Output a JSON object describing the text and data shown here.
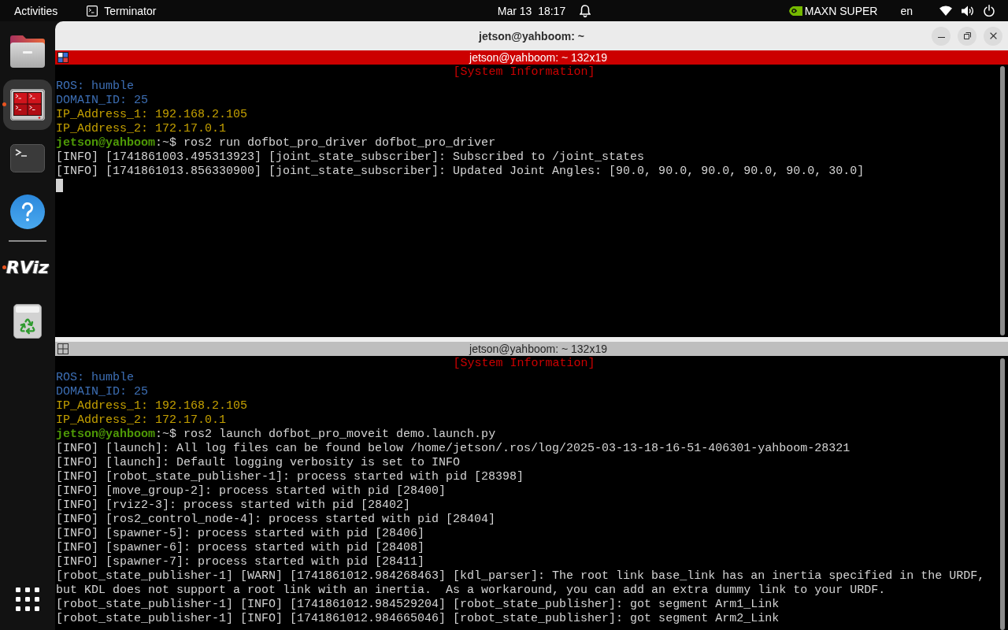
{
  "top_bar": {
    "activities": "Activities",
    "app_menu": "Terminator",
    "clock": "Mar 13  18:17",
    "power_mode": "MAXN SUPER",
    "keyboard_layout": "en"
  },
  "dock": {
    "items": [
      {
        "kind": "files",
        "running": false,
        "selected": false
      },
      {
        "kind": "terminator",
        "running": true,
        "selected": true
      },
      {
        "kind": "terminal",
        "running": false,
        "selected": false
      },
      {
        "kind": "help",
        "running": false,
        "selected": false
      },
      {
        "kind": "separator"
      },
      {
        "kind": "rviz",
        "label": "RViz",
        "running": true,
        "selected": false
      },
      {
        "kind": "trash",
        "running": false,
        "selected": false
      }
    ]
  },
  "window": {
    "title": "jetson@yahboom: ~",
    "panes": [
      {
        "title": "jetson@yahboom: ~ 132x19",
        "focused": true,
        "cursor": true,
        "lines": [
          {
            "kind": "banner",
            "text": "[System Information]"
          },
          {
            "kind": "env",
            "text": "ROS: humble"
          },
          {
            "kind": "env",
            "text": "DOMAIN_ID: 25"
          },
          {
            "kind": "address",
            "text": "IP_Address_1: 192.168.2.105"
          },
          {
            "kind": "address",
            "text": "IP_Address_2: 172.17.0.1"
          },
          {
            "kind": "prompt",
            "user_host": "jetson@yahboom",
            "prompt": ":~$",
            "command": "ros2 run dofbot_pro_driver dofbot_pro_driver"
          },
          {
            "kind": "output",
            "text": "[INFO] [1741861003.495313923] [joint_state_subscriber]: Subscribed to /joint_states"
          },
          {
            "kind": "output",
            "text": "[INFO] [1741861013.856330900] [joint_state_subscriber]: Updated Joint Angles: [90.0, 90.0, 90.0, 90.0, 90.0, 30.0]"
          }
        ]
      },
      {
        "title": "jetson@yahboom: ~ 132x19",
        "focused": false,
        "cursor": false,
        "lines": [
          {
            "kind": "banner",
            "text": "[System Information]"
          },
          {
            "kind": "env",
            "text": "ROS: humble"
          },
          {
            "kind": "env",
            "text": "DOMAIN_ID: 25"
          },
          {
            "kind": "address",
            "text": "IP_Address_1: 192.168.2.105"
          },
          {
            "kind": "address",
            "text": "IP_Address_2: 172.17.0.1"
          },
          {
            "kind": "prompt",
            "user_host": "jetson@yahboom",
            "prompt": ":~$",
            "command": "ros2 launch dofbot_pro_moveit demo.launch.py"
          },
          {
            "kind": "output",
            "text": "[INFO] [launch]: All log files can be found below /home/jetson/.ros/log/2025-03-13-18-16-51-406301-yahboom-28321"
          },
          {
            "kind": "output",
            "text": "[INFO] [launch]: Default logging verbosity is set to INFO"
          },
          {
            "kind": "output",
            "text": "[INFO] [robot_state_publisher-1]: process started with pid [28398]"
          },
          {
            "kind": "output",
            "text": "[INFO] [move_group-2]: process started with pid [28400]"
          },
          {
            "kind": "output",
            "text": "[INFO] [rviz2-3]: process started with pid [28402]"
          },
          {
            "kind": "output",
            "text": "[INFO] [ros2_control_node-4]: process started with pid [28404]"
          },
          {
            "kind": "output",
            "text": "[INFO] [spawner-5]: process started with pid [28406]"
          },
          {
            "kind": "output",
            "text": "[INFO] [spawner-6]: process started with pid [28408]"
          },
          {
            "kind": "output",
            "text": "[INFO] [spawner-7]: process started with pid [28411]"
          },
          {
            "kind": "output",
            "text": "[robot_state_publisher-1] [WARN] [1741861012.984268463] [kdl_parser]: The root link base_link has an inertia specified in the URDF, but KDL does not support a root link with an inertia.  As a workaround, you can add an extra dummy link to your URDF."
          },
          {
            "kind": "output",
            "text": "[robot_state_publisher-1] [INFO] [1741861012.984529204] [robot_state_publisher]: got segment Arm1_Link"
          },
          {
            "kind": "output",
            "text": "[robot_state_publisher-1] [INFO] [1741861012.984665046] [robot_state_publisher]: got segment Arm2_Link"
          }
        ]
      }
    ]
  }
}
